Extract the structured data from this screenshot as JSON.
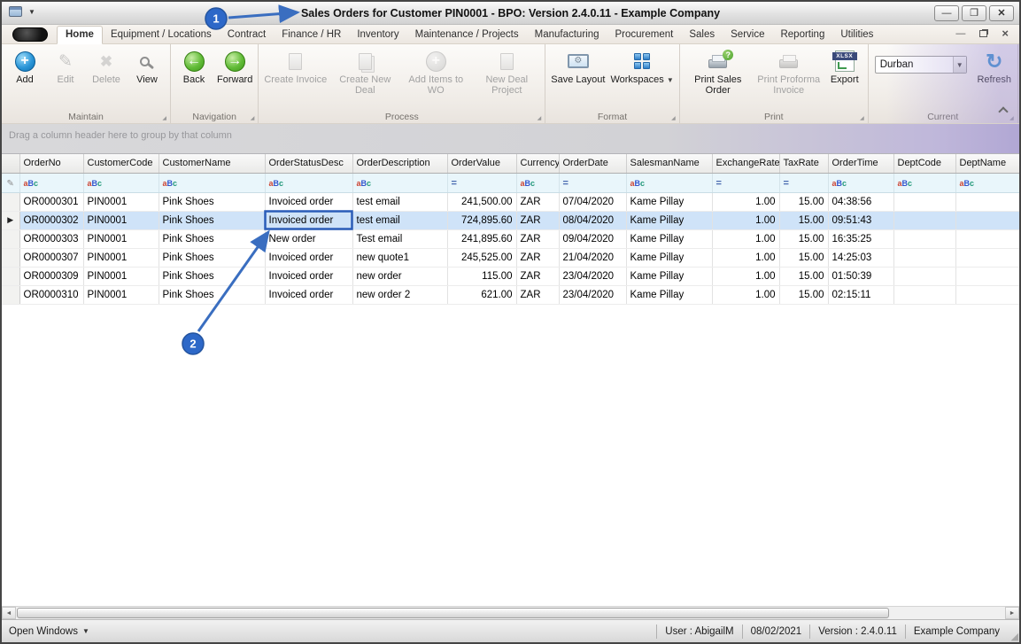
{
  "window_title": "Sales Orders for Customer PIN0001 - BPO: Version 2.4.0.11 - Example Company",
  "tabs": [
    {
      "label": "Home",
      "active": true
    },
    {
      "label": "Equipment / Locations"
    },
    {
      "label": "Contract"
    },
    {
      "label": "Finance / HR"
    },
    {
      "label": "Inventory"
    },
    {
      "label": "Maintenance / Projects"
    },
    {
      "label": "Manufacturing"
    },
    {
      "label": "Procurement"
    },
    {
      "label": "Sales"
    },
    {
      "label": "Service"
    },
    {
      "label": "Reporting"
    },
    {
      "label": "Utilities"
    }
  ],
  "ribbon": {
    "groups": [
      {
        "label": "Maintain",
        "buttons": [
          {
            "label": "Add",
            "icon": "add-circle-icon",
            "enabled": true
          },
          {
            "label": "Edit",
            "icon": "edit-pencil-icon",
            "enabled": false
          },
          {
            "label": "Delete",
            "icon": "delete-x-icon",
            "enabled": false
          },
          {
            "label": "View",
            "icon": "view-magnifier-icon",
            "enabled": true
          }
        ]
      },
      {
        "label": "Navigation",
        "buttons": [
          {
            "label": "Back",
            "icon": "back-arrow-icon",
            "enabled": true
          },
          {
            "label": "Forward",
            "icon": "forward-arrow-icon",
            "enabled": true
          }
        ]
      },
      {
        "label": "Process",
        "buttons": [
          {
            "label": "Create Invoice",
            "icon": "invoice-doc-icon",
            "enabled": false
          },
          {
            "label": "Create New Deal",
            "icon": "new-deal-doc-icon",
            "enabled": false
          },
          {
            "label": "Add Items to WO",
            "icon": "add-items-icon",
            "enabled": false
          },
          {
            "label": "New Deal Project",
            "icon": "project-doc-icon",
            "enabled": false
          }
        ]
      },
      {
        "label": "Format",
        "buttons": [
          {
            "label": "Save Layout",
            "icon": "save-layout-icon",
            "enabled": true
          },
          {
            "label": "Workspaces",
            "icon": "workspaces-grid-icon",
            "enabled": true,
            "has_caret": true
          }
        ]
      },
      {
        "label": "Print",
        "buttons": [
          {
            "label": "Print Sales Order",
            "icon": "print-sales-order-icon",
            "enabled": true
          },
          {
            "label": "Print Proforma Invoice",
            "icon": "print-proforma-icon",
            "enabled": false
          },
          {
            "label": "Export",
            "icon": "export-xlsx-icon",
            "enabled": true,
            "icon_text": "XLSX"
          }
        ]
      },
      {
        "label": "Current",
        "combo": {
          "value": "Durban"
        },
        "buttons": [
          {
            "label": "Refresh",
            "icon": "refresh-icon",
            "enabled": true
          }
        ]
      }
    ]
  },
  "grid": {
    "group_hint": "Drag a column header here to group by that column",
    "filter_text_icon": "aBc",
    "filter_numeric_icon": "=",
    "columns": [
      {
        "label": "OrderNo",
        "filter": "text"
      },
      {
        "label": "CustomerCode",
        "filter": "text"
      },
      {
        "label": "CustomerName",
        "filter": "text"
      },
      {
        "label": "OrderStatusDesc",
        "filter": "text"
      },
      {
        "label": "OrderDescription",
        "filter": "text"
      },
      {
        "label": "OrderValue",
        "filter": "numeric"
      },
      {
        "label": "Currency",
        "filter": "text"
      },
      {
        "label": "OrderDate",
        "filter": "numeric"
      },
      {
        "label": "SalesmanName",
        "filter": "text"
      },
      {
        "label": "ExchangeRate",
        "filter": "numeric"
      },
      {
        "label": "TaxRate",
        "filter": "numeric"
      },
      {
        "label": "OrderTime",
        "filter": "text"
      },
      {
        "label": "DeptCode",
        "filter": "text"
      },
      {
        "label": "DeptName",
        "filter": "text"
      }
    ],
    "rows": [
      {
        "selected": false,
        "cells": [
          "OR0000301",
          "PIN0001",
          "Pink Shoes",
          "Invoiced order",
          "test email",
          "241,500.00",
          "ZAR",
          "07/04/2020",
          "Kame Pillay",
          "1.00",
          "15.00",
          "04:38:56",
          "",
          ""
        ]
      },
      {
        "selected": true,
        "cells": [
          "OR0000302",
          "PIN0001",
          "Pink Shoes",
          "Invoiced order",
          "test email",
          "724,895.60",
          "ZAR",
          "08/04/2020",
          "Kame Pillay",
          "1.00",
          "15.00",
          "09:51:43",
          "",
          ""
        ]
      },
      {
        "selected": false,
        "cells": [
          "OR0000303",
          "PIN0001",
          "Pink Shoes",
          "New order",
          "Test email",
          "241,895.60",
          "ZAR",
          "09/04/2020",
          "Kame Pillay",
          "1.00",
          "15.00",
          "16:35:25",
          "",
          ""
        ]
      },
      {
        "selected": false,
        "cells": [
          "OR0000307",
          "PIN0001",
          "Pink Shoes",
          "Invoiced order",
          "new quote1",
          "245,525.00",
          "ZAR",
          "21/04/2020",
          "Kame Pillay",
          "1.00",
          "15.00",
          "14:25:03",
          "",
          ""
        ]
      },
      {
        "selected": false,
        "cells": [
          "OR0000309",
          "PIN0001",
          "Pink Shoes",
          "Invoiced order",
          "new order",
          "115.00",
          "ZAR",
          "23/04/2020",
          "Kame Pillay",
          "1.00",
          "15.00",
          "01:50:39",
          "",
          ""
        ]
      },
      {
        "selected": false,
        "cells": [
          "OR0000310",
          "PIN0001",
          "Pink Shoes",
          "Invoiced order",
          "new order 2",
          "621.00",
          "ZAR",
          "23/04/2020",
          "Kame Pillay",
          "1.00",
          "15.00",
          "02:15:11",
          "",
          ""
        ]
      }
    ]
  },
  "status_bar": {
    "open_windows": "Open Windows",
    "items": [
      "User : AbigailM",
      "08/02/2021",
      "Version : 2.4.0.11",
      "Example Company"
    ]
  },
  "annotations": {
    "steps": [
      {
        "label": "1"
      },
      {
        "label": "2"
      }
    ]
  }
}
